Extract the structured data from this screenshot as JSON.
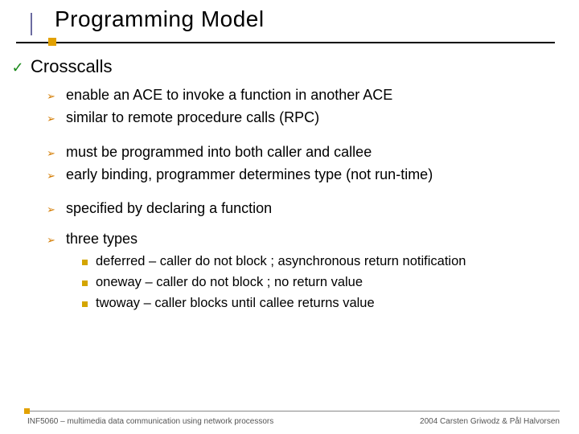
{
  "title": "Programming Model",
  "heading": "Crosscalls",
  "groups": [
    {
      "items": [
        "enable an ACE to invoke a function in another ACE",
        "similar to remote procedure calls (RPC)"
      ]
    },
    {
      "items": [
        "must be programmed into both caller and callee",
        "early binding, programmer determines type (not run-time)"
      ]
    },
    {
      "items": [
        "specified by declaring a function"
      ]
    },
    {
      "items": [
        "three types"
      ]
    }
  ],
  "subitems": [
    "deferred – caller do not block ; asynchronous return notification",
    "oneway – caller do not block ; no return value",
    "twoway – caller blocks until callee returns value"
  ],
  "footer": {
    "left": "INF5060 – multimedia data communication using network processors",
    "right": "2004  Carsten Griwodz & Pål Halvorsen"
  }
}
